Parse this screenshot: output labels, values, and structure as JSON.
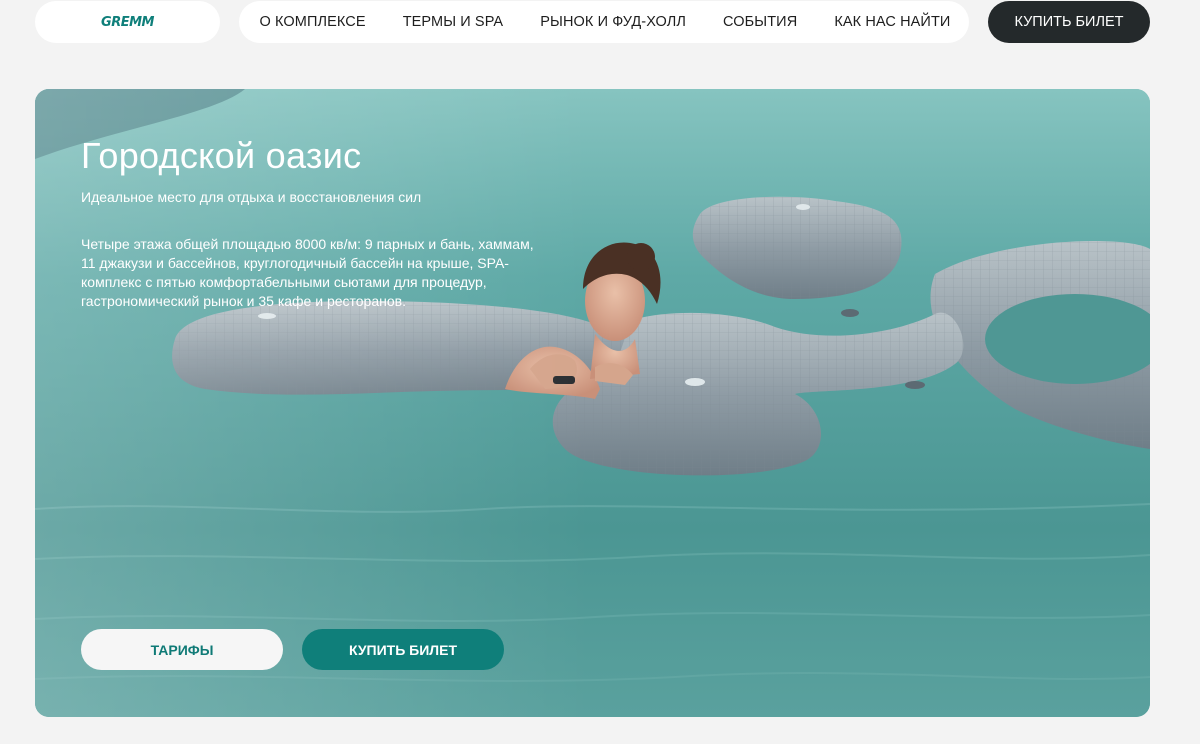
{
  "header": {
    "logo": "GREMM",
    "nav": [
      {
        "label": "О КОМПЛЕКСЕ"
      },
      {
        "label": "ТЕРМЫ И SPA"
      },
      {
        "label": "РЫНОК И ФУД-ХОЛЛ"
      },
      {
        "label": "СОБЫТИЯ"
      },
      {
        "label": "КАК НАС НАЙТИ"
      }
    ],
    "buy_label": "КУПИТЬ БИЛЕТ"
  },
  "hero": {
    "title": "Городской оазис",
    "subtitle": "Идеальное место для отдыха и восстановления сил",
    "description": "Четыре этажа общей площадью 8000 кв/м: 9 парных и бань, хаммам, 11 джакузи и бассейнов, круглогодичный бассейн на крыше, SPA-комплекс с пятью комфортабельными сьютами для процедур, гастрономический рынок и 35 кафе и ресторанов.",
    "tariffs_label": "ТАРИФЫ",
    "buy_label": "КУПИТЬ БИЛЕТ",
    "image": "woman-relaxing-in-pool-photo"
  },
  "colors": {
    "accent": "#0f7f7a",
    "dark_button": "#24292b",
    "page_bg": "#f3f3f3",
    "water": "#4e9a98"
  }
}
